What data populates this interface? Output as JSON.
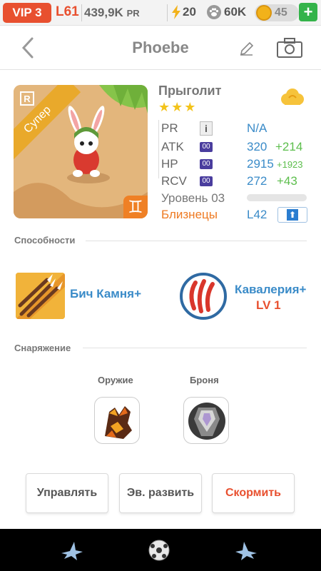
{
  "status_bar": {
    "vip": "VIP 3",
    "level": "L61",
    "power": "439,9K",
    "power_unit": "PR",
    "energy": "20",
    "paw_points": "60K",
    "coins": "45",
    "add_label": "+"
  },
  "header": {
    "title": "Phoebe"
  },
  "monster": {
    "name": "Прыголит",
    "stars": "★★★",
    "rarity": "R",
    "tier_label": "Супер",
    "zodiac_symbol": "♊",
    "stats": {
      "pr": {
        "label": "PR",
        "info": "i",
        "value": "N/A"
      },
      "atk": {
        "label": "ATK",
        "tag": "00",
        "value": "320",
        "bonus": "+214"
      },
      "hp": {
        "label": "HP",
        "tag": "00",
        "value": "2915",
        "bonus": "+1923"
      },
      "rcv": {
        "label": "RCV",
        "tag": "00",
        "value": "272",
        "bonus": "+43"
      }
    },
    "level_text": "Уровень 03",
    "level_progress": 0,
    "sign": "Близнецы",
    "max_level": "L42",
    "upgrade_arrow": "⬆"
  },
  "abilities": {
    "header": "Способности",
    "skill1": {
      "name": "Бич Камня+"
    },
    "skill2": {
      "name": "Кавалерия+",
      "level": "LV 1"
    }
  },
  "equipment": {
    "header": "Снаряжение",
    "weapon_label": "Оружие",
    "armor_label": "Броня"
  },
  "actions": {
    "manage": "Управлять",
    "evolve": "Эв. развить",
    "feed": "Скормить"
  },
  "colors": {
    "accent_red": "#e8502f",
    "link_blue": "#3a8bc8",
    "bonus_green": "#5cbe4c",
    "star_yellow": "#f3c31a",
    "zodiac_orange": "#ee7a22"
  }
}
